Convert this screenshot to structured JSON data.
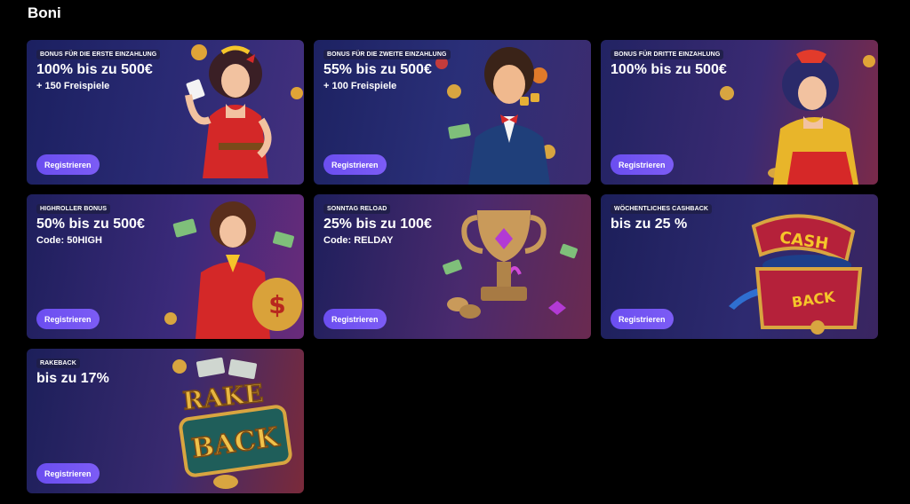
{
  "page": {
    "title": "Boni"
  },
  "cards": [
    {
      "badge": "BONUS FÜR DIE ERSTE EINZAHLUNG",
      "headline": "100% bis zu 500€",
      "subline": "+ 150 Freispiele",
      "button": "Registrieren",
      "art": "pinup-woman-red-dress-icon"
    },
    {
      "badge": "BONUS FÜR DIE ZWEITE EINZAHLUNG",
      "headline": "55% bis zu 500€",
      "subline": "+ 100 Freispiele",
      "button": "Registrieren",
      "art": "man-with-dice-icon"
    },
    {
      "badge": "BONUS FÜR DRITTE EINZAHLUNG",
      "headline": "100% bis zu 500€",
      "subline": "",
      "button": "Registrieren",
      "art": "pinup-woman-yellow-top-icon"
    },
    {
      "badge": "HIGHROLLER BONUS",
      "headline": "50% bis zu 500€",
      "subline": "Code: 50HIGH",
      "button": "Registrieren",
      "art": "woman-with-money-bag-icon"
    },
    {
      "badge": "SONNTAG RELOAD",
      "headline": "25% bis zu 100€",
      "subline": "Code: RELDAY",
      "button": "Registrieren",
      "art": "trophy-icon"
    },
    {
      "badge": "WÖCHENTLICHES CASHBACK",
      "headline": "bis zu 25 %",
      "subline": "",
      "button": "Registrieren",
      "art": "cashback-chest-icon"
    },
    {
      "badge": "RAKEBACK",
      "headline": "bis zu 17%",
      "subline": "",
      "button": "Registrieren",
      "art": "rakeback-sign-icon"
    }
  ],
  "art_text": {
    "cash": "CASH",
    "back": "BACK",
    "rake": "RAKE"
  },
  "colors": {
    "button": "#7c5cf5",
    "background": "#000000"
  }
}
